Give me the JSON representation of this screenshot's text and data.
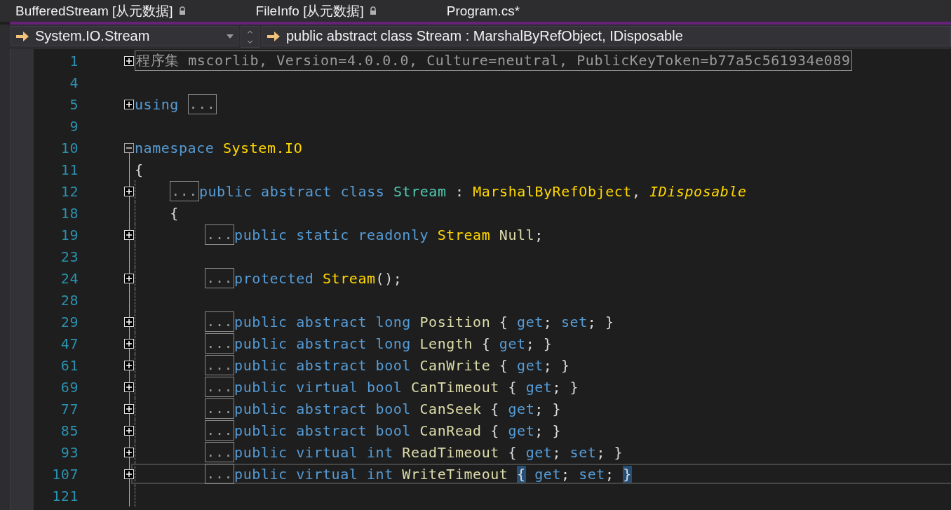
{
  "tabs": [
    {
      "label": "BufferedStream [从元数据]",
      "locked": true,
      "selected": false
    },
    {
      "label": "FileInfo [从元数据]",
      "locked": true,
      "selected": false
    },
    {
      "label": "Program.cs*",
      "locked": false,
      "selected": false
    }
  ],
  "navigation": {
    "type_dropdown": "System.IO.Stream",
    "member_dropdown": "public abstract class Stream : MarshalByRefObject, IDisposable"
  },
  "editor": {
    "lines": [
      {
        "number": "1",
        "expanded": false,
        "tokens": [
          {
            "text": "程序集 mscorlib, Version=4.0.0.0, Culture=neutral, PublicKeyToken=b77a5c561934e089",
            "kind": "collapsed"
          }
        ]
      },
      {
        "number": "4"
      },
      {
        "number": "5",
        "expanded": false,
        "tokens": [
          {
            "text": "using ",
            "kind": "keyword"
          },
          {
            "text": "...",
            "kind": "collapsed"
          }
        ]
      },
      {
        "number": "9"
      },
      {
        "number": "10",
        "expanded": true,
        "tokens": [
          {
            "text": "namespace ",
            "kind": "keyword"
          },
          {
            "text": "System.IO",
            "kind": "type"
          }
        ]
      },
      {
        "number": "11",
        "tokens": [
          {
            "text": "{",
            "kind": "punct"
          }
        ],
        "children": [
          {
            "number": "12",
            "expanded": false,
            "tokens": [
              {
                "text": "...",
                "kind": "collapsed"
              },
              {
                "text": "public abstract class ",
                "kind": "keyword"
              },
              {
                "text": "Stream",
                "kind": "class"
              },
              {
                "text": " : ",
                "kind": "punct"
              },
              {
                "text": "MarshalByRefObject",
                "kind": "type"
              },
              {
                "text": ", ",
                "kind": "punct"
              },
              {
                "text": "IDisposable",
                "kind": "interface"
              }
            ]
          },
          {
            "number": "18",
            "tokens": [
              {
                "text": "{",
                "kind": "punct"
              }
            ],
            "children": [
              {
                "number": "19",
                "expanded": false,
                "tokens": [
                  {
                    "text": "...",
                    "kind": "collapsed"
                  },
                  {
                    "text": "public static readonly ",
                    "kind": "keyword"
                  },
                  {
                    "text": "Stream",
                    "kind": "type"
                  },
                  {
                    "text": " Null",
                    "kind": "member"
                  },
                  {
                    "text": ";",
                    "kind": "punct"
                  }
                ]
              },
              {
                "number": "23"
              },
              {
                "number": "24",
                "expanded": false,
                "tokens": [
                  {
                    "text": "...",
                    "kind": "collapsed"
                  },
                  {
                    "text": "protected ",
                    "kind": "keyword"
                  },
                  {
                    "text": "Stream",
                    "kind": "type"
                  },
                  {
                    "text": "();",
                    "kind": "punct"
                  }
                ]
              },
              {
                "number": "28"
              },
              {
                "number": "29",
                "expanded": false,
                "tokens": [
                  {
                    "text": "...",
                    "kind": "collapsed"
                  },
                  {
                    "text": "public abstract long ",
                    "kind": "keyword"
                  },
                  {
                    "text": "Position",
                    "kind": "member"
                  },
                  {
                    "text": " { ",
                    "kind": "punct"
                  },
                  {
                    "text": "get",
                    "kind": "keyword"
                  },
                  {
                    "text": "; ",
                    "kind": "punct"
                  },
                  {
                    "text": "set",
                    "kind": "keyword"
                  },
                  {
                    "text": "; }",
                    "kind": "punct"
                  }
                ]
              },
              {
                "number": "47",
                "expanded": false,
                "tokens": [
                  {
                    "text": "...",
                    "kind": "collapsed"
                  },
                  {
                    "text": "public abstract long ",
                    "kind": "keyword"
                  },
                  {
                    "text": "Length",
                    "kind": "member"
                  },
                  {
                    "text": " { ",
                    "kind": "punct"
                  },
                  {
                    "text": "get",
                    "kind": "keyword"
                  },
                  {
                    "text": "; }",
                    "kind": "punct"
                  }
                ]
              },
              {
                "number": "61",
                "expanded": false,
                "tokens": [
                  {
                    "text": "...",
                    "kind": "collapsed"
                  },
                  {
                    "text": "public abstract bool ",
                    "kind": "keyword"
                  },
                  {
                    "text": "CanWrite",
                    "kind": "member"
                  },
                  {
                    "text": " { ",
                    "kind": "punct"
                  },
                  {
                    "text": "get",
                    "kind": "keyword"
                  },
                  {
                    "text": "; }",
                    "kind": "punct"
                  }
                ]
              },
              {
                "number": "69",
                "expanded": false,
                "tokens": [
                  {
                    "text": "...",
                    "kind": "collapsed"
                  },
                  {
                    "text": "public virtual bool ",
                    "kind": "keyword"
                  },
                  {
                    "text": "CanTimeout",
                    "kind": "member"
                  },
                  {
                    "text": " { ",
                    "kind": "punct"
                  },
                  {
                    "text": "get",
                    "kind": "keyword"
                  },
                  {
                    "text": "; }",
                    "kind": "punct"
                  }
                ]
              },
              {
                "number": "77",
                "expanded": false,
                "tokens": [
                  {
                    "text": "...",
                    "kind": "collapsed"
                  },
                  {
                    "text": "public abstract bool ",
                    "kind": "keyword"
                  },
                  {
                    "text": "CanSeek",
                    "kind": "member"
                  },
                  {
                    "text": " { ",
                    "kind": "punct"
                  },
                  {
                    "text": "get",
                    "kind": "keyword"
                  },
                  {
                    "text": "; }",
                    "kind": "punct"
                  }
                ]
              },
              {
                "number": "85",
                "expanded": false,
                "tokens": [
                  {
                    "text": "...",
                    "kind": "collapsed"
                  },
                  {
                    "text": "public abstract bool ",
                    "kind": "keyword"
                  },
                  {
                    "text": "CanRead",
                    "kind": "member"
                  },
                  {
                    "text": " { ",
                    "kind": "punct"
                  },
                  {
                    "text": "get",
                    "kind": "keyword"
                  },
                  {
                    "text": "; }",
                    "kind": "punct"
                  }
                ]
              },
              {
                "number": "93",
                "expanded": false,
                "tokens": [
                  {
                    "text": "...",
                    "kind": "collapsed"
                  },
                  {
                    "text": "public virtual int ",
                    "kind": "keyword"
                  },
                  {
                    "text": "ReadTimeout",
                    "kind": "member"
                  },
                  {
                    "text": " { ",
                    "kind": "punct"
                  },
                  {
                    "text": "get",
                    "kind": "keyword"
                  },
                  {
                    "text": "; ",
                    "kind": "punct"
                  },
                  {
                    "text": "set",
                    "kind": "keyword"
                  },
                  {
                    "text": "; }",
                    "kind": "punct"
                  }
                ]
              },
              {
                "number": "107",
                "expanded": false,
                "current": true,
                "tokens": [
                  {
                    "text": "...",
                    "kind": "collapsed"
                  },
                  {
                    "text": "public virtual int ",
                    "kind": "keyword"
                  },
                  {
                    "text": "WriteTimeout ",
                    "kind": "member"
                  },
                  {
                    "text": "{",
                    "kind": "punct",
                    "highlighted": true
                  },
                  {
                    "text": " get",
                    "kind": "keyword"
                  },
                  {
                    "text": "; ",
                    "kind": "punct"
                  },
                  {
                    "text": "set",
                    "kind": "keyword"
                  },
                  {
                    "text": "; ",
                    "kind": "punct"
                  },
                  {
                    "text": "}",
                    "kind": "punct",
                    "highlighted": true
                  }
                ]
              },
              {
                "number": "121"
              }
            ]
          }
        ]
      }
    ]
  }
}
